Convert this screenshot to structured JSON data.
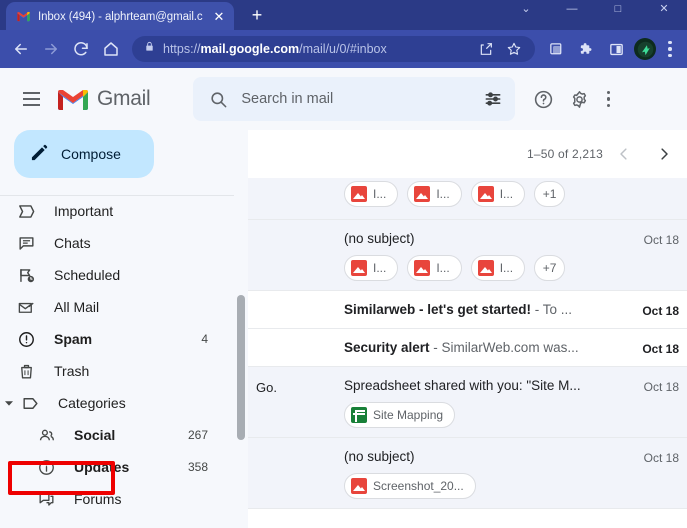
{
  "browser": {
    "tab": {
      "title": "Inbox (494) - alphrteam@gmail.c",
      "favicon": "gmail-favicon",
      "close_label": "✕"
    },
    "new_tab_label": "+",
    "window_controls": [
      "⌄",
      "—",
      "□",
      "✕"
    ],
    "nav": {
      "back": "back-icon",
      "forward": "forward-icon",
      "reload": "reload-icon",
      "home": "home-icon"
    },
    "omnibox": {
      "lock": "lock-icon",
      "url_prefix": "https://",
      "url_domain": "mail.google.com",
      "url_suffix": "/mail/u/0/#inbox",
      "full_url": "https://mail.google.com/mail/u/0/#inbox",
      "share": "share-icon",
      "bookmark": "star-icon"
    },
    "toolbar_icons": [
      "screenshot-icon",
      "extensions-puzzle-icon",
      "side-panel-icon",
      "profile-avatar-icon",
      "chrome-menu-icon"
    ]
  },
  "gmail": {
    "header": {
      "menu": "hamburger-icon",
      "logo": "gmail-logo",
      "brand": "Gmail",
      "search_placeholder": "Search in mail",
      "search_value": "",
      "search_icon": "search-icon",
      "filter_icon": "search-options-icon",
      "support_icon": "help-icon",
      "settings_icon": "gear-icon",
      "apps_icon": "google-apps-icon"
    },
    "compose": {
      "label": "Compose",
      "icon": "pencil-icon"
    },
    "sidebar": {
      "items": [
        {
          "label": "Important",
          "icon": "important-label-icon",
          "count": "",
          "bold": false,
          "sub": false
        },
        {
          "label": "Chats",
          "icon": "chat-icon",
          "count": "",
          "bold": false,
          "sub": false
        },
        {
          "label": "Scheduled",
          "icon": "scheduled-send-icon",
          "count": "",
          "bold": false,
          "sub": false
        },
        {
          "label": "All Mail",
          "icon": "all-mail-icon",
          "count": "",
          "bold": false,
          "sub": false
        },
        {
          "label": "Spam",
          "icon": "spam-alert-icon",
          "count": "4",
          "bold": true,
          "sub": false
        },
        {
          "label": "Trash",
          "icon": "trash-icon",
          "count": "",
          "bold": false,
          "sub": false
        }
      ],
      "categories": {
        "label": "Categories",
        "icon": "label-tag-icon",
        "caret": "caret-down-icon",
        "items": [
          {
            "label": "Social",
            "icon": "social-people-icon",
            "count": "267",
            "bold": true
          },
          {
            "label": "Updates",
            "icon": "updates-info-icon",
            "count": "358",
            "bold": true
          },
          {
            "label": "Forums",
            "icon": "forums-icon",
            "count": "",
            "bold": false
          }
        ]
      },
      "highlight_color": "#ee0000",
      "highlighted_item": "Spam"
    },
    "list": {
      "pagination": {
        "range": "1–50 of 2,213",
        "prev_icon": "chevron-left-icon",
        "next_icon": "chevron-right-icon"
      },
      "rows": [
        {
          "sender": "",
          "subject": "",
          "snippet": "",
          "bold": false,
          "date": "",
          "read": true,
          "partial_top": true,
          "chips": [
            {
              "name": "I...",
              "type": "image"
            },
            {
              "name": "I...",
              "type": "image"
            },
            {
              "name": "I...",
              "type": "image"
            },
            {
              "name": "+1",
              "type": "more"
            }
          ]
        },
        {
          "sender": "",
          "subject": "(no subject)",
          "snippet": "",
          "bold": false,
          "date": "Oct 18",
          "read": true,
          "partial_top": false,
          "chips": [
            {
              "name": "I...",
              "type": "image"
            },
            {
              "name": "I...",
              "type": "image"
            },
            {
              "name": "I...",
              "type": "image"
            },
            {
              "name": "+7",
              "type": "more"
            }
          ]
        },
        {
          "sender": "",
          "subject": "Similarweb - let's get started!",
          "snippet": " - To ...",
          "bold": true,
          "date": "Oct 18",
          "read": false,
          "partial_top": false,
          "chips": []
        },
        {
          "sender": "",
          "subject": "Security alert",
          "snippet": " - SimilarWeb.com was...",
          "bold": true,
          "date": "Oct 18",
          "read": false,
          "partial_top": false,
          "chips": []
        },
        {
          "sender": "Go.",
          "subject": "Spreadsheet shared with you: \"Site M...",
          "snippet": "",
          "bold": false,
          "date": "Oct 18",
          "read": true,
          "partial_top": false,
          "chips": [
            {
              "name": "Site Mapping",
              "type": "sheet"
            }
          ]
        },
        {
          "sender": "",
          "subject": "(no subject)",
          "snippet": "",
          "bold": false,
          "date": "Oct 18",
          "read": true,
          "partial_top": false,
          "chips": [
            {
              "name": "Screenshot_20...",
              "type": "image"
            }
          ]
        }
      ]
    }
  }
}
